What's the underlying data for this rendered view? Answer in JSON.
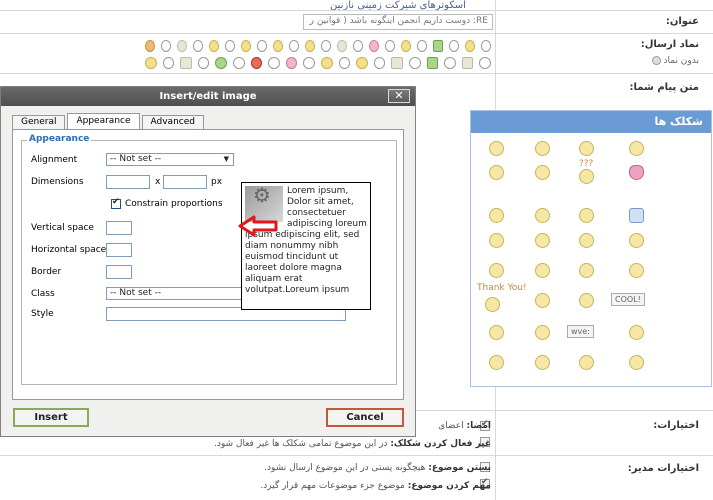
{
  "background": {
    "top_cut_text": "اسکوترهای شیرکت زمینی نازنین",
    "labels": {
      "subject": "عنوان:",
      "send_symbol": "نماد ارسال:",
      "message_text": "متن پیام شما:",
      "options": "اختیارات:",
      "admin_options": "اختیارات مدیر:"
    },
    "subject_value": "RE: دوست داریم انجمن اینگونه باشد ( قوانین ر",
    "no_symbol_label": "بدون نماد",
    "smiley_panel_title": "شکلک ها",
    "smiley_texts": {
      "question_marks": "???",
      "thank_you": "Thank You!",
      "cool": "COOL!",
      "wve": "wve:"
    },
    "options_rows": [
      {
        "bold": "امضا:",
        "text": "اعضای"
      },
      {
        "bold": "غیر فعال کردن شکلک:",
        "text": "در این موضوع تمامی شکلک ها غیر فعال شود."
      },
      {
        "bold": "بستن موضوع:",
        "text": "هیچگونه پستی در این موضوع ارسال نشود."
      },
      {
        "bold": "مهم کردن موضوع:",
        "text": "موضوع جزء موضوعات مهم قرار گیرد."
      }
    ]
  },
  "dialog": {
    "title": "Insert/edit image",
    "close_icon": "close-icon",
    "tabs": [
      "General",
      "Appearance",
      "Advanced"
    ],
    "active_tab": "Appearance",
    "legend": "Appearance",
    "fields": {
      "alignment_label": "Alignment",
      "alignment_value": "-- Not set --",
      "dimensions_label": "Dimensions",
      "dimensions_sep": "x",
      "dimensions_unit": "px",
      "constrain_label": "Constrain proportions",
      "vspace_label": "Vertical space",
      "hspace_label": "Horizontal space",
      "border_label": "Border",
      "class_label": "Class",
      "class_value": "-- Not set --",
      "style_label": "Style"
    },
    "preview_text": "Lorem ipsum, Dolor sit amet, consectetuer adipiscing loreum ipsum edipiscing elit, sed diam nonummy nibh euismod tincidunt ut laoreet dolore magna aliquam erat volutpat.Loreum ipsum",
    "buttons": {
      "insert": "Insert",
      "cancel": "Cancel"
    },
    "accent_color": "#2b6fb6",
    "annotation_arrow_color": "#e01818"
  }
}
